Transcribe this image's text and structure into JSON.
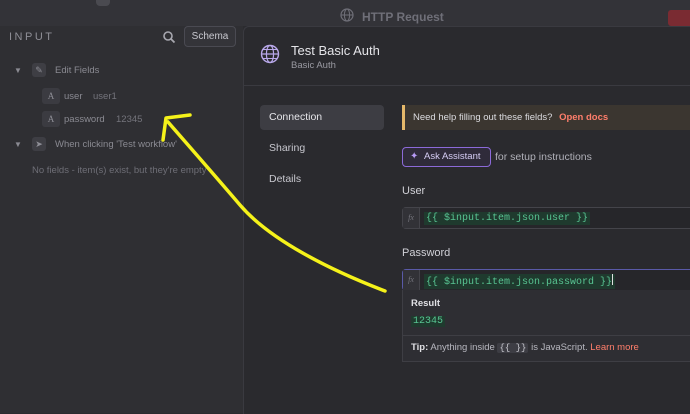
{
  "background": {
    "http_node_title": "HTTP Request"
  },
  "input_panel": {
    "title": "INPUT",
    "schema_label": "Schema",
    "edit_fields_label": "Edit Fields",
    "fields": [
      {
        "type": "A",
        "name": "user",
        "value": "user1"
      },
      {
        "type": "A",
        "name": "password",
        "value": "12345"
      }
    ],
    "trigger_label": "When clicking 'Test workflow'",
    "empty_message": "No fields - item(s) exist, but they're empty"
  },
  "modal": {
    "title": "Test Basic Auth",
    "subtitle": "Basic Auth",
    "nav": [
      {
        "label": "Connection",
        "active": true
      },
      {
        "label": "Sharing",
        "active": false
      },
      {
        "label": "Details",
        "active": false
      }
    ],
    "help_text": "Need help filling out these fields?",
    "help_link": "Open docs",
    "assist_button": "Ask Assistant",
    "assist_note": "for setup instructions",
    "user_label": "User",
    "user_expression": "{{ $input.item.json.user }}",
    "password_label": "Password",
    "password_expression": "{{ $input.item.json.password }}",
    "fx_label": "fx",
    "result_label": "Result",
    "result_value": "12345",
    "tip_label": "Tip:",
    "tip_text_pre": "Anything inside",
    "tip_braces": "{{ }}",
    "tip_text_post": "is JavaScript.",
    "tip_link": "Learn more"
  },
  "colors": {
    "annotation_arrow": "#f5f21a",
    "accent_link": "#ff7e6b",
    "expression_green": "#58c492"
  }
}
